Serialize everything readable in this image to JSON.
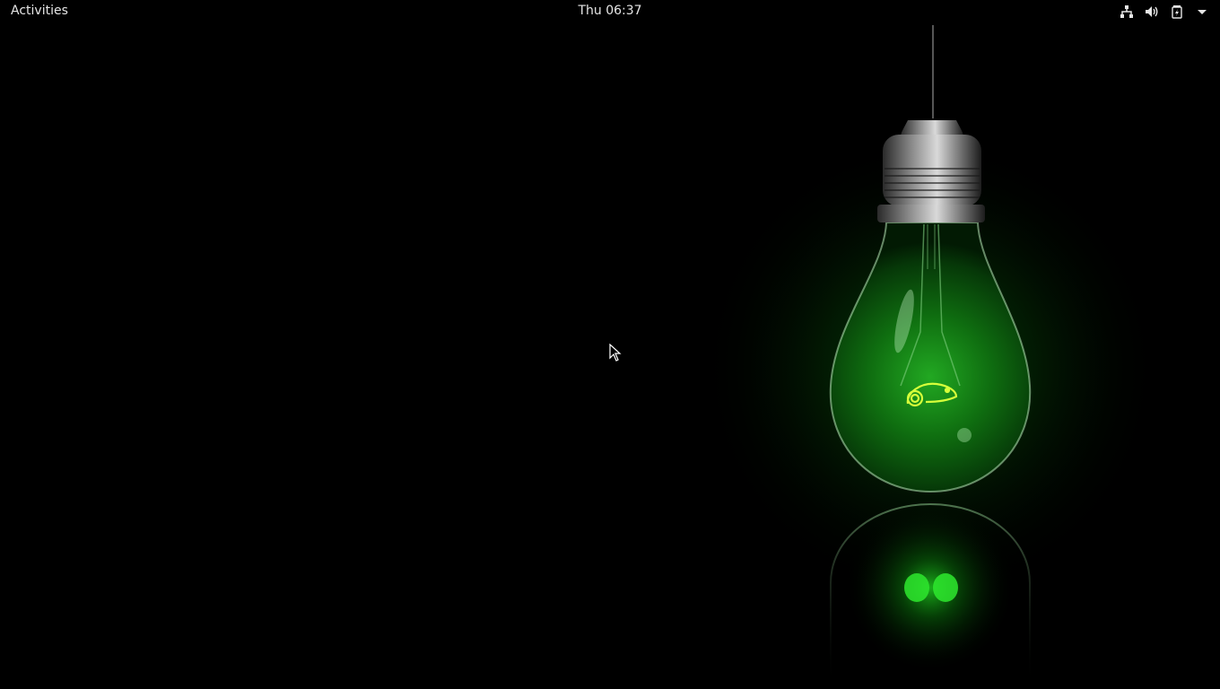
{
  "top_bar": {
    "activities_label": "Activities",
    "clock_text": "Thu 06:37",
    "tray_icons": [
      "network-wired-icon",
      "volume-icon",
      "battery-charging-icon",
      "system-menu-arrow-icon"
    ]
  },
  "wallpaper": {
    "description_icon": "lightbulb-chameleon-icon",
    "glow_color": "#1dd31d",
    "background_color": "#000000"
  }
}
